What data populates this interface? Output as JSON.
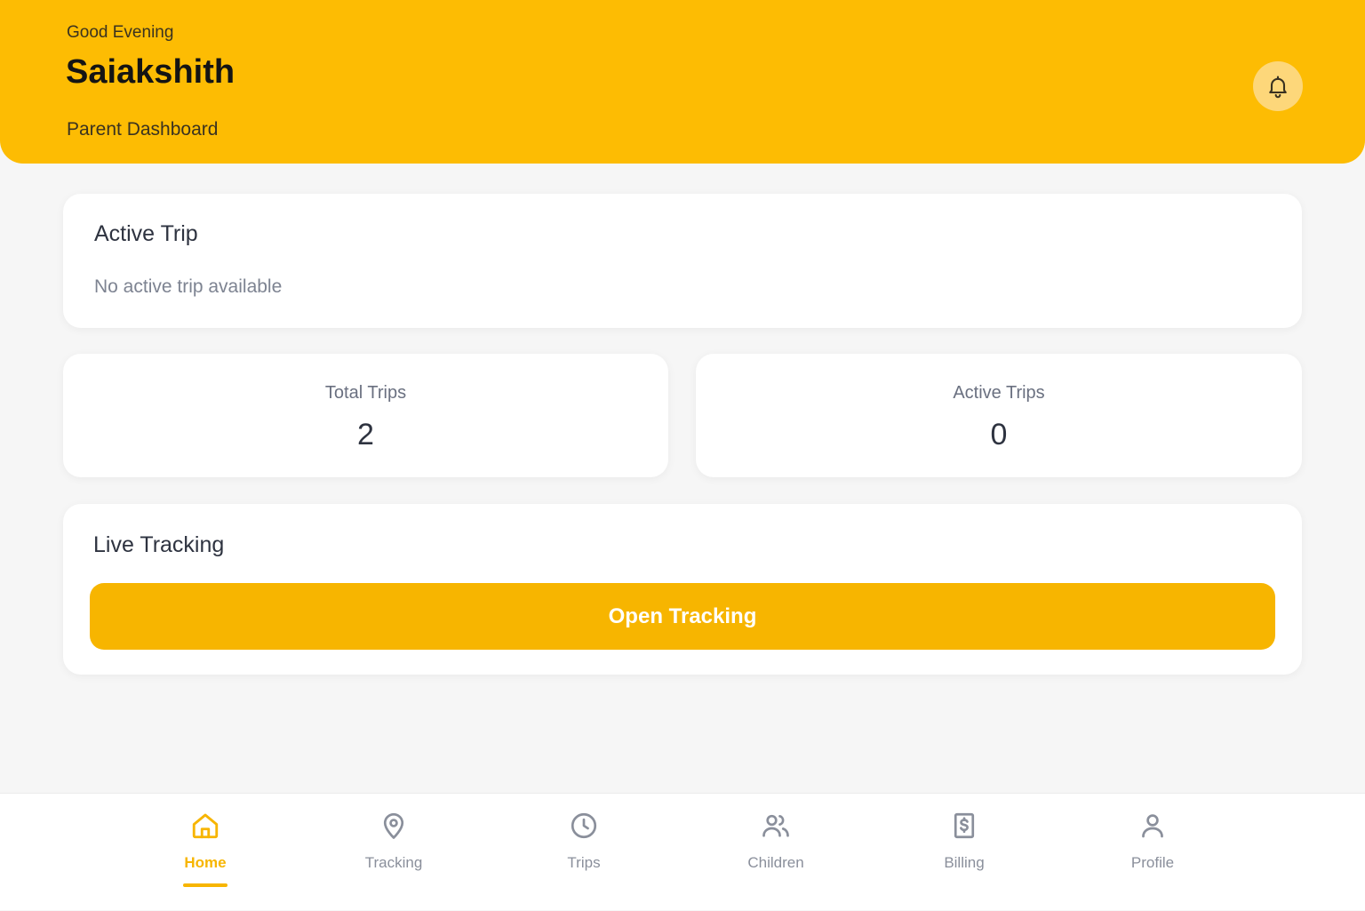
{
  "header": {
    "greeting": "Good Evening",
    "user_name": "Saiakshith",
    "subtitle": "Parent Dashboard",
    "notification_icon": "bell-icon"
  },
  "active_trip": {
    "title": "Active Trip",
    "empty_text": "No active trip available"
  },
  "stats": [
    {
      "label": "Total Trips",
      "value": "2"
    },
    {
      "label": "Active Trips",
      "value": "0"
    }
  ],
  "live_tracking": {
    "title": "Live Tracking",
    "button_label": "Open Tracking"
  },
  "nav": {
    "active": "Home",
    "items": [
      {
        "label": "Home",
        "icon": "home-icon"
      },
      {
        "label": "Tracking",
        "icon": "map-pin-icon"
      },
      {
        "label": "Trips",
        "icon": "clock-icon"
      },
      {
        "label": "Children",
        "icon": "users-icon"
      },
      {
        "label": "Billing",
        "icon": "billing-icon"
      },
      {
        "label": "Profile",
        "icon": "user-icon"
      }
    ]
  },
  "colors": {
    "brand": "#fdbc03",
    "accent": "#f7b500",
    "background": "#f6f6f6",
    "inactive": "#8a8f9b"
  }
}
